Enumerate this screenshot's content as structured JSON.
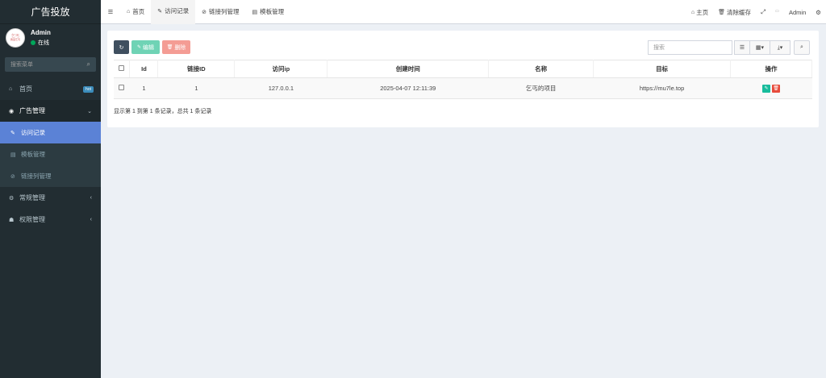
{
  "sidebar": {
    "logo": "广告投放",
    "avatar_text_top": "乞丐",
    "avatar_text_bottom": "我爱乞丐",
    "user_name": "Admin",
    "user_status": "在线",
    "search_placeholder": "搜索菜单",
    "items": [
      {
        "label": "首页",
        "icon": "home-icon",
        "badge": "hot"
      },
      {
        "label": "广告管理",
        "icon": "ad-icon",
        "arrow": "⌄"
      },
      {
        "label": "访问记录",
        "icon": "pencil-icon"
      },
      {
        "label": "模板管理",
        "icon": "template-icon"
      },
      {
        "label": "链接列管理",
        "icon": "link-icon"
      },
      {
        "label": "常规管理",
        "icon": "gears-icon",
        "arrow": "‹"
      },
      {
        "label": "权限管理",
        "icon": "users-icon",
        "arrow": "‹"
      }
    ]
  },
  "topbar": {
    "tabs": [
      {
        "label": "首页",
        "icon": "home-icon"
      },
      {
        "label": "访问记录",
        "icon": "pencil-icon"
      },
      {
        "label": "链接列管理",
        "icon": "link-icon"
      },
      {
        "label": "模板管理",
        "icon": "template-icon"
      }
    ],
    "right": {
      "home": "主页",
      "clear_cache": "清除缓存",
      "user": "Admin"
    }
  },
  "toolbar": {
    "edit": "编辑",
    "delete": "删除",
    "search_placeholder": "搜索"
  },
  "table": {
    "headers": [
      "Id",
      "链接ID",
      "访问ip",
      "创建时间",
      "名称",
      "目标",
      "操作"
    ],
    "rows": [
      {
        "id": "1",
        "link_id": "1",
        "ip": "127.0.0.1",
        "created": "2025-04-07 12:11:39",
        "name": "乞丐的项目",
        "target": "https://mu7le.top"
      }
    ]
  },
  "pagination": {
    "info": "显示第 1 到第 1 条记录，总共 1 条记录"
  },
  "colors": {
    "sidebar_bg": "#222d32",
    "active_item": "#5b82d6",
    "edit_green": "#18bc9c",
    "delete_red": "#e74c3c"
  }
}
